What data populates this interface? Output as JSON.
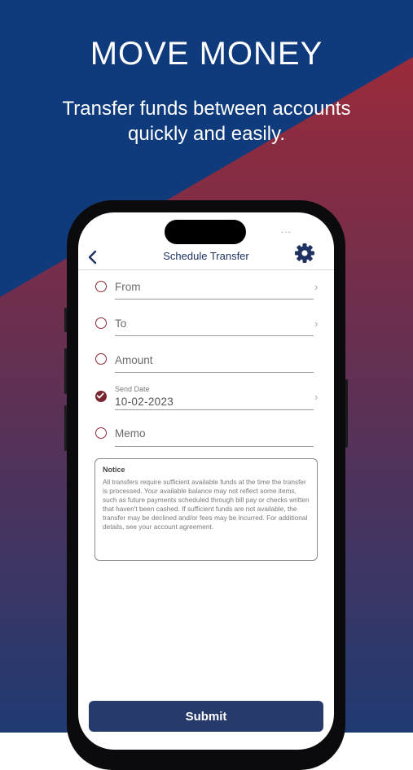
{
  "hero": {
    "title": "MOVE MONEY",
    "subtitle": "Transfer funds between accounts quickly and easily."
  },
  "colors": {
    "bg_blue": "#0f3b7c",
    "bg_red": "#a52a35",
    "bg_bottom": "#213a70",
    "accent_red": "#8b2a34",
    "button": "#263a6b",
    "title_blue": "#1e3263"
  },
  "status_bar": {
    "dots": "..."
  },
  "nav": {
    "back_icon": "chevron-left-icon",
    "title": "Schedule Transfer",
    "settings_icon": "gear-icon"
  },
  "form": {
    "from_label": "From",
    "to_label": "To",
    "amount_label": "Amount",
    "send_date_label": "Send Date",
    "send_date_value": "10-02-2023",
    "memo_label": "Memo"
  },
  "notice": {
    "title": "Notice",
    "body": "All transfers require sufficient available funds at the time the transfer is processed. Your available balance may not reflect some items, such as future payments scheduled through bill pay or checks written that haven't been cashed. If sufficient funds are not available, the transfer may be declined and/or fees may be incurred. For additional details, see your account agreement."
  },
  "submit_label": "Submit"
}
